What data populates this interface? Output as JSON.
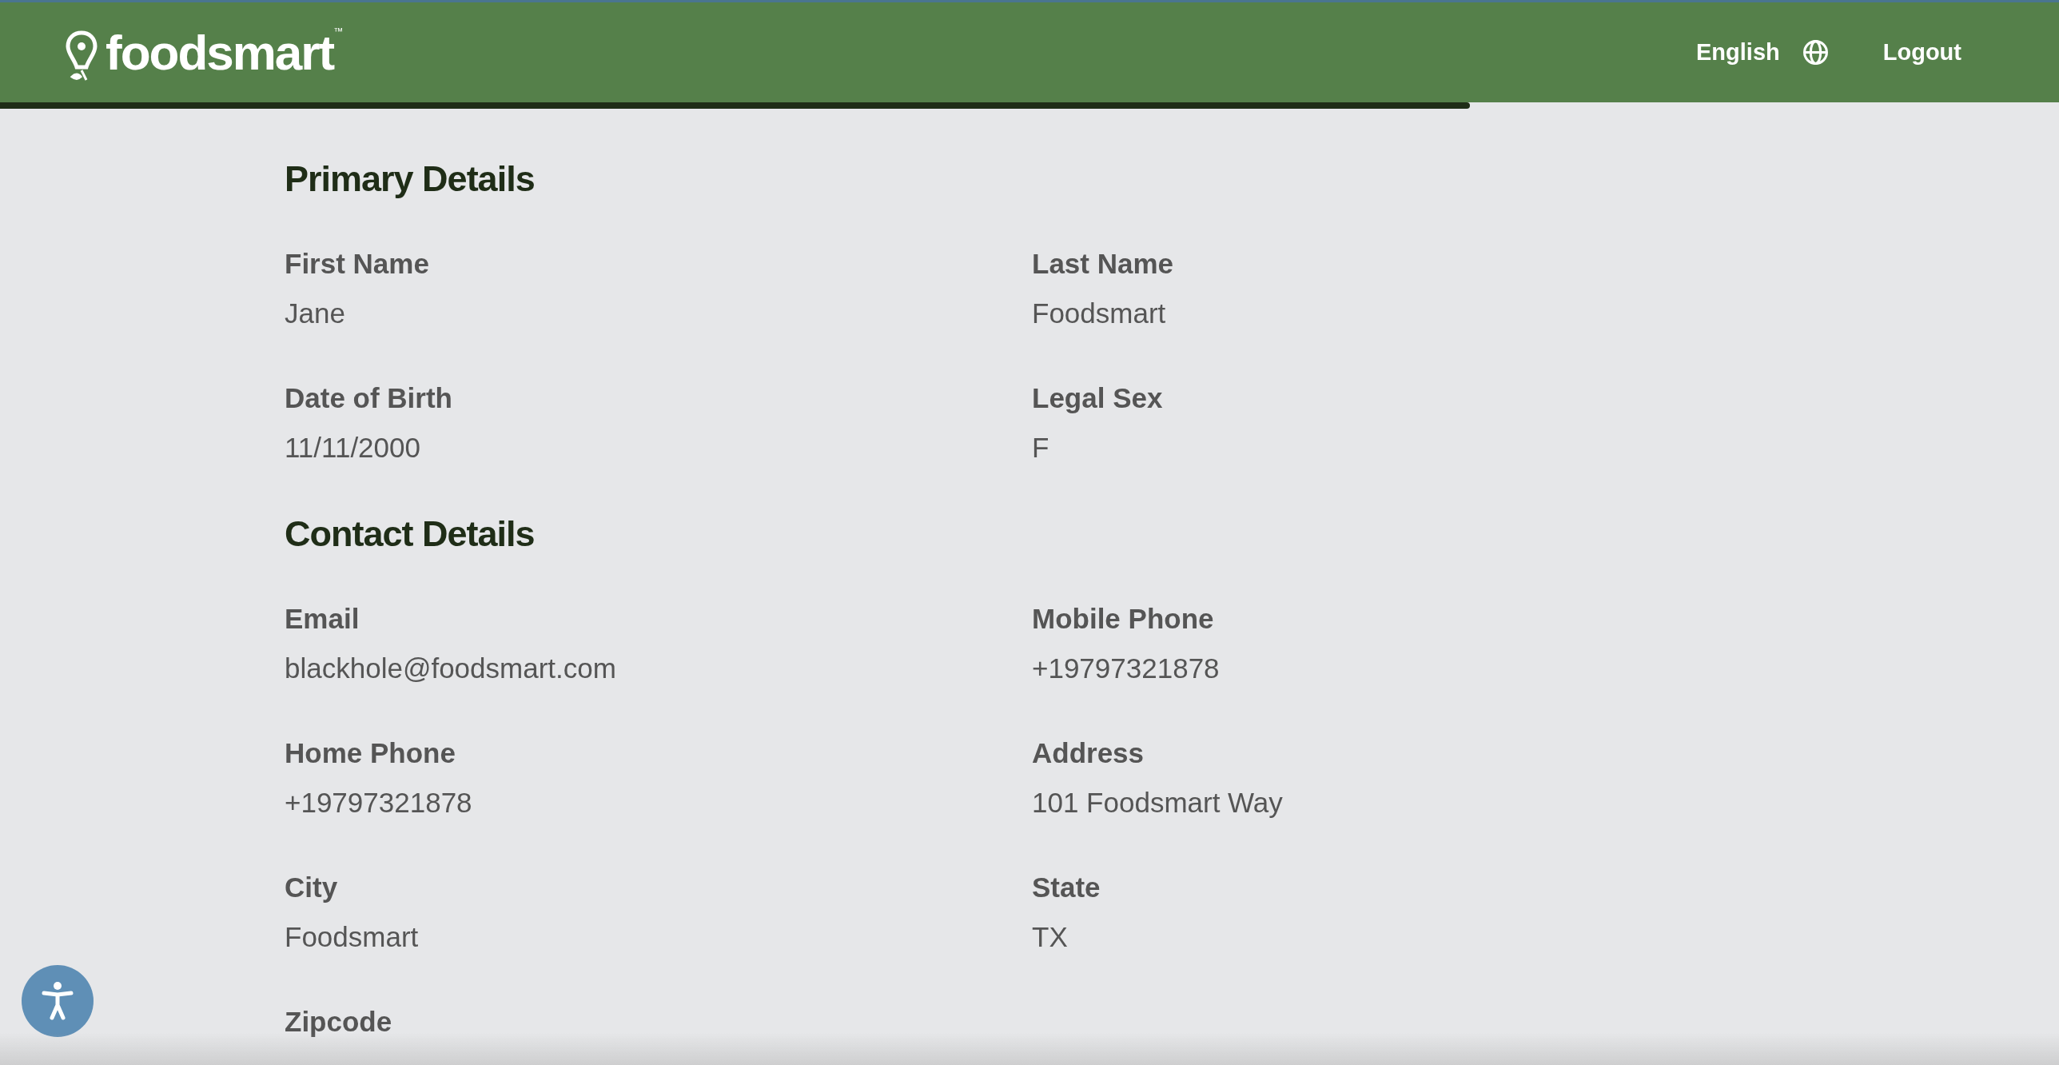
{
  "header": {
    "logo": {
      "name": "foodsmart",
      "trademark": "™"
    },
    "language": "English",
    "logout": "Logout"
  },
  "progress": {
    "level": 0.714
  },
  "sections": [
    {
      "title": "Primary Details",
      "fields": [
        {
          "label": "First Name",
          "value": "Jane"
        },
        {
          "label": "Last Name",
          "value": "Foodsmart"
        },
        {
          "label": "Date of Birth",
          "value": "11/11/2000"
        },
        {
          "label": "Legal Sex",
          "value": "F"
        }
      ]
    },
    {
      "title": "Contact Details",
      "fields": [
        {
          "label": "Email",
          "value": "blackhole@foodsmart.com"
        },
        {
          "label": "Mobile Phone",
          "value": "+19797321878"
        },
        {
          "label": "Home Phone",
          "value": "+19797321878"
        },
        {
          "label": "Address",
          "value": "101 Foodsmart Way"
        },
        {
          "label": "City",
          "value": "Foodsmart"
        },
        {
          "label": "State",
          "value": "TX"
        },
        {
          "label": "Zipcode"
        }
      ]
    }
  ]
}
